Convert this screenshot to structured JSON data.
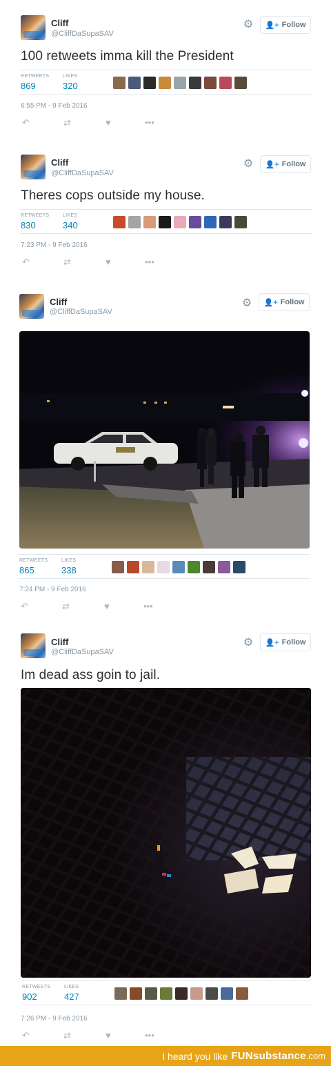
{
  "tweets": [
    {
      "name": "Cliff",
      "handle": "@CliffDaSupaSAV",
      "follow_label": "Follow",
      "text": "100 retweets imma kill the President",
      "retweets_label": "RETWEETS",
      "retweets": "869",
      "likes_label": "LIKES",
      "likes": "320",
      "date": "6:55 PM - 9 Feb 2016"
    },
    {
      "name": "Cliff",
      "handle": "@CliffDaSupaSAV",
      "follow_label": "Follow",
      "text": "Theres cops outside my house.",
      "retweets_label": "RETWEETS",
      "retweets": "830",
      "likes_label": "LIKES",
      "likes": "340",
      "date": "7:23 PM - 9 Feb 2016"
    },
    {
      "name": "Cliff",
      "handle": "@CliffDaSupaSAV",
      "follow_label": "Follow",
      "text": "",
      "retweets_label": "RETWEETS",
      "retweets": "865",
      "likes_label": "LIKES",
      "likes": "338",
      "date": "7:24 PM - 9 Feb 2016"
    },
    {
      "name": "Cliff",
      "handle": "@CliffDaSupaSAV",
      "follow_label": "Follow",
      "text": "Im dead ass goin to jail.",
      "retweets_label": "RETWEETS",
      "retweets": "902",
      "likes_label": "LIKES",
      "likes": "427",
      "date": "7:26 PM - 9 Feb 2016"
    }
  ],
  "icons": {
    "gear": "gear-icon",
    "follow": "add-user-icon",
    "reply": "reply-icon",
    "retweet": "retweet-icon",
    "like": "heart-icon",
    "more": "more-icon"
  },
  "footer": {
    "prefix": "I heard you like",
    "brand": "FUNsubstance",
    "domain": ".com"
  },
  "colors": {
    "link_blue": "#0084b4",
    "muted": "#8899a6",
    "border": "#e1e8ed",
    "footer_bg": "#e8a417"
  }
}
